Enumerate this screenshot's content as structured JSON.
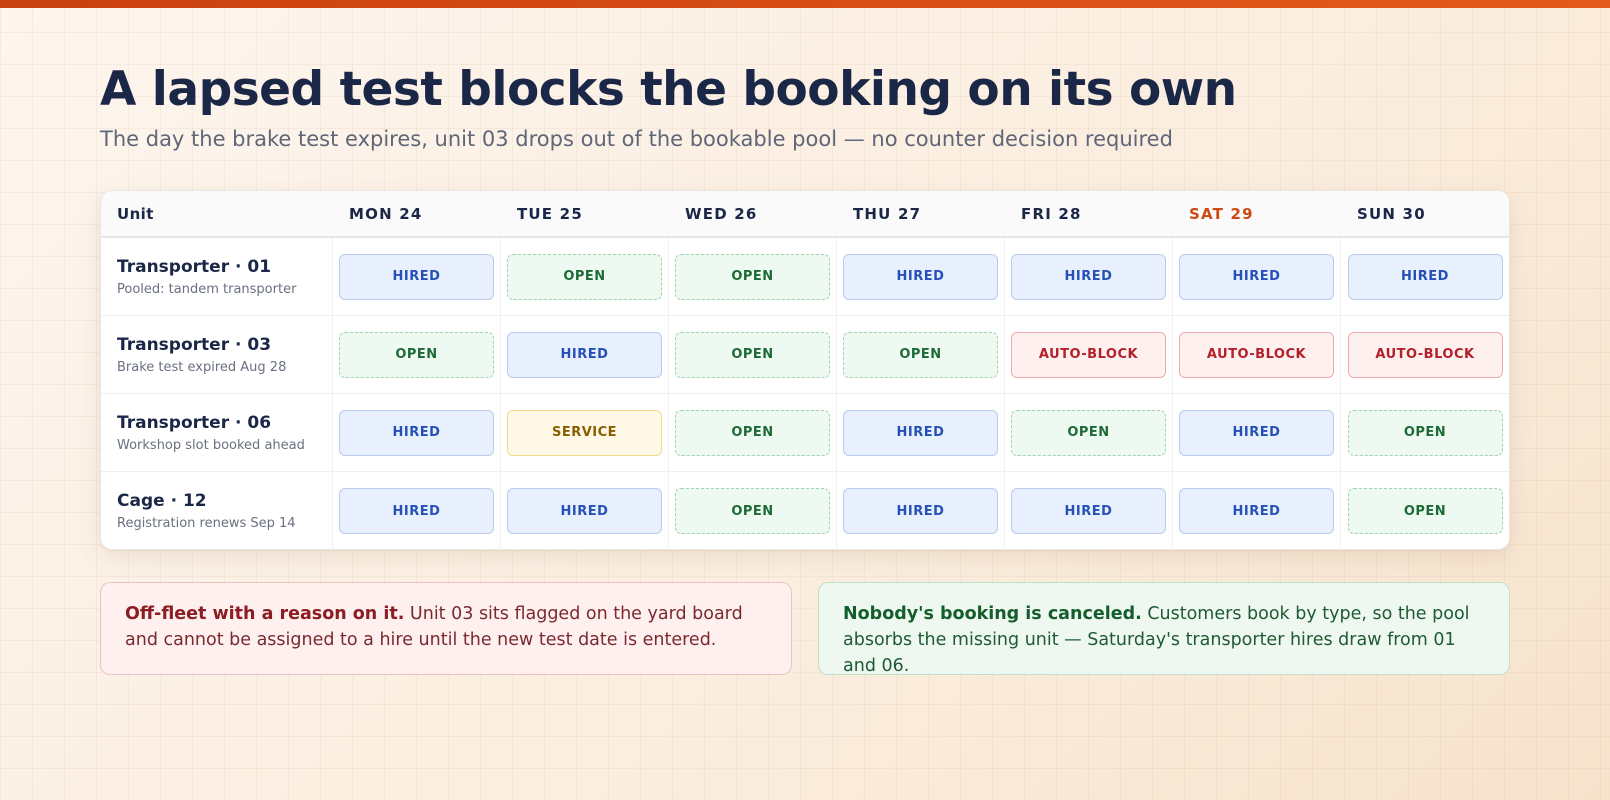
{
  "title": "A lapsed test blocks the booking on its own",
  "subtitle": "The day the brake test expires, unit 03 drops out of the bookable pool — no counter decision required",
  "colors": {
    "accent": "#d9531e",
    "weekend": "#cc4a12",
    "hired": "#2450b8",
    "open": "#1c6b36",
    "service": "#8a5d00",
    "auto_block": "#b4202a"
  },
  "board": {
    "unit_header": "Unit",
    "days": [
      {
        "label": "MON 24",
        "weekend": false
      },
      {
        "label": "TUE 25",
        "weekend": false
      },
      {
        "label": "WED 26",
        "weekend": false
      },
      {
        "label": "THU 27",
        "weekend": false
      },
      {
        "label": "FRI 28",
        "weekend": false
      },
      {
        "label": "SAT 29",
        "weekend": true
      },
      {
        "label": "SUN 30",
        "weekend": false
      }
    ],
    "rows": [
      {
        "name": "Transporter · 01",
        "note": "Pooled: tandem transporter",
        "cells": [
          "HIRED",
          "OPEN",
          "OPEN",
          "HIRED",
          "HIRED",
          "HIRED",
          "HIRED"
        ]
      },
      {
        "name": "Transporter · 03",
        "note": "Brake test expired Aug 28",
        "cells": [
          "OPEN",
          "HIRED",
          "OPEN",
          "OPEN",
          "AUTO-BLOCK",
          "AUTO-BLOCK",
          "AUTO-BLOCK"
        ]
      },
      {
        "name": "Transporter · 06",
        "note": "Workshop slot booked ahead",
        "cells": [
          "HIRED",
          "SERVICE",
          "OPEN",
          "HIRED",
          "OPEN",
          "HIRED",
          "OPEN"
        ]
      },
      {
        "name": "Cage · 12",
        "note": "Registration renews Sep 14",
        "cells": [
          "HIRED",
          "HIRED",
          "OPEN",
          "HIRED",
          "HIRED",
          "HIRED",
          "OPEN"
        ]
      }
    ]
  },
  "notes": {
    "warning": {
      "lead": "Off-fleet with a reason on it.",
      "body": " Unit 03 sits flagged on the yard board and cannot be assigned to a hire until the new test date is entered."
    },
    "info": {
      "lead": "Nobody's booking is canceled.",
      "body": " Customers book by type, so the pool absorbs the missing unit — Saturday's transporter hires draw from 01 and 06."
    }
  }
}
